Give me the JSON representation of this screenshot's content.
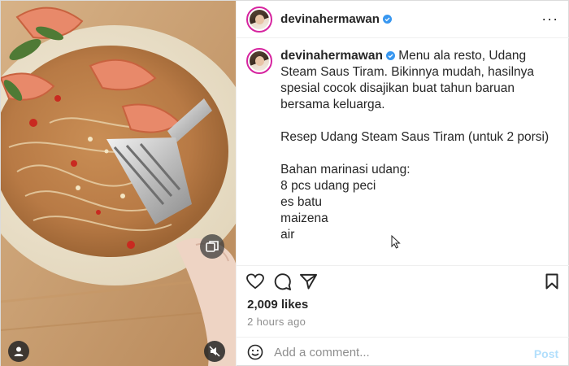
{
  "header": {
    "username": "devinahermawan",
    "verified_color": "#3897f0",
    "more_icon": "more-horizontal-icon"
  },
  "caption": {
    "username": "devinahermawan",
    "text": "Menu ala resto, Udang Steam Saus Tiram. Bikinnya mudah, hasilnya spesial cocok disajikan buat tahun baruan bersama keluarga.\n\nResep Udang Steam Saus Tiram (untuk 2 porsi)\n\nBahan marinasi udang:\n8 pcs udang peci\nes batu\nmaizena\nair"
  },
  "actions": {
    "icons": [
      "heart-icon",
      "comment-icon",
      "share-icon",
      "bookmark-icon"
    ]
  },
  "likes": "2,009 likes",
  "time": "2 hours ago",
  "comment": {
    "placeholder": "Add a comment...",
    "post_label": "Post",
    "post_color": "#b2dffc"
  },
  "media": {
    "icons": [
      "carousel-icon",
      "user-tag-icon",
      "mute-icon"
    ]
  }
}
